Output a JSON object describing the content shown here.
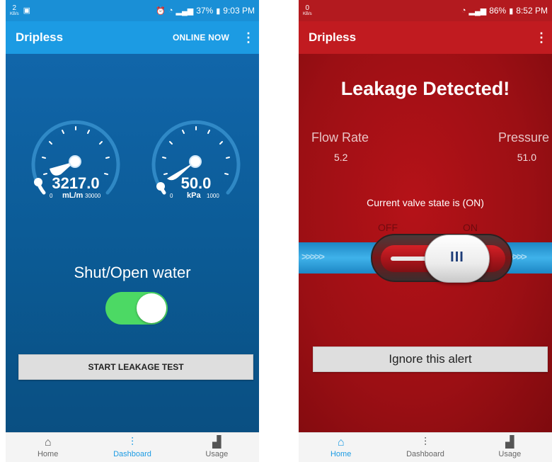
{
  "left": {
    "status": {
      "speed_value": "2",
      "speed_unit": "KB/s",
      "battery": "37%",
      "time": "9:03 PM"
    },
    "appbar": {
      "title": "Dripless",
      "online": "ONLINE NOW"
    },
    "gauges": [
      {
        "value": "3217.0",
        "unit": "mL/m",
        "min": "0",
        "max": "30000",
        "fraction": 0.11
      },
      {
        "value": "50.0",
        "unit": "kPa",
        "min": "0",
        "max": "1000",
        "fraction": 0.05
      }
    ],
    "shut_label": "Shut/Open water",
    "toggle_on": true,
    "leak_button": "START LEAKAGE TEST",
    "nav": [
      {
        "label": "Home",
        "icon": "home-icon"
      },
      {
        "label": "Dashboard",
        "icon": "dashboard-icon"
      },
      {
        "label": "Usage",
        "icon": "usage-chart-icon"
      }
    ],
    "nav_active": "Dashboard",
    "colors": {
      "appbar": "#1c9be3",
      "toggle": "#4cd964"
    }
  },
  "right": {
    "status": {
      "speed_value": "0",
      "speed_unit": "KB/s",
      "battery": "86%",
      "time": "8:52 PM"
    },
    "appbar": {
      "title": "Dripless"
    },
    "alert_title": "Leakage Detected!",
    "flow_label": "Flow Rate",
    "flow_value": "5.2",
    "pressure_label": "Pressure",
    "pressure_value": "51.0",
    "valve_state": "Current valve state is (ON)",
    "off_label": "OFF",
    "on_label": "ON",
    "ignore_button": "Ignore this alert",
    "nav": [
      {
        "label": "Home",
        "icon": "home-icon"
      },
      {
        "label": "Dashboard",
        "icon": "dashboard-icon"
      },
      {
        "label": "Usage",
        "icon": "usage-chart-icon"
      }
    ],
    "nav_active": "Home",
    "colors": {
      "appbar": "#c11b20",
      "background": "#9b0f14"
    }
  }
}
